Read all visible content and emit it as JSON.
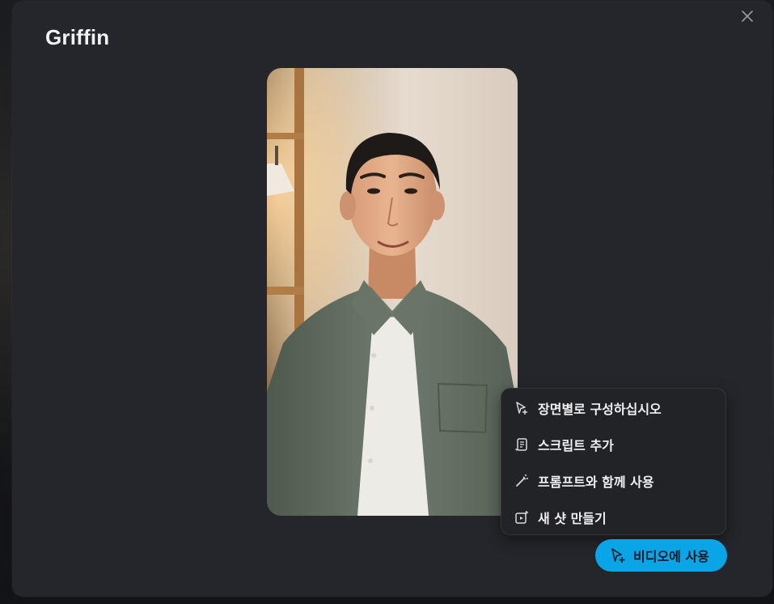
{
  "dialog": {
    "title": "Griffin",
    "close_icon": "close-icon"
  },
  "preview": {
    "image": "avatar-portrait"
  },
  "menu": {
    "items": [
      {
        "icon": "cursor-plus-icon",
        "label": "장면별로 구성하십시오"
      },
      {
        "icon": "script-icon",
        "label": "스크립트 추가"
      },
      {
        "icon": "magic-wand-icon",
        "label": "프롬프트와 함께 사용"
      },
      {
        "icon": "new-shot-icon",
        "label": "새 샷 만들기"
      }
    ]
  },
  "primary_action": {
    "icon": "cursor-plus-icon",
    "label": "비디오에 사용",
    "color": "#0aa5e6"
  }
}
